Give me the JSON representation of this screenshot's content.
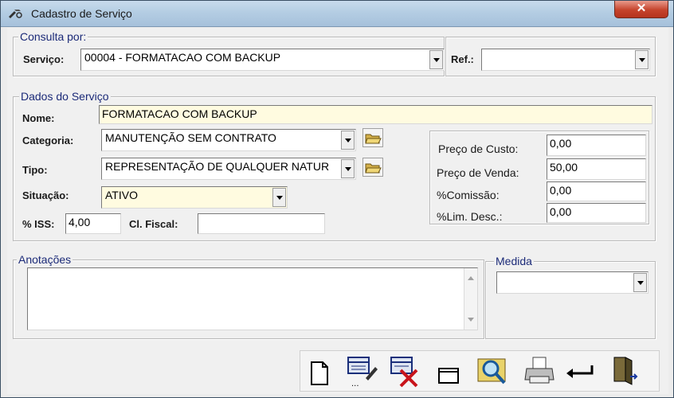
{
  "window": {
    "title": "Cadastro de Serviço",
    "close_label": "✕"
  },
  "consulta": {
    "legend": "Consulta por:",
    "servico_label": "Serviço:",
    "servico_value": "00004 - FORMATACAO COM BACKUP",
    "ref_label": "Ref.:",
    "ref_value": ""
  },
  "dados": {
    "legend": "Dados do Serviço",
    "nome_label": "Nome:",
    "nome_value": "FORMATACAO COM BACKUP",
    "categoria_label": "Categoria:",
    "categoria_value": "MANUTENÇÃO SEM CONTRATO",
    "tipo_label": "Tipo:",
    "tipo_value": "REPRESENTAÇÃO DE QUALQUER NATUR",
    "situacao_label": "Situação:",
    "situacao_value": "ATIVO",
    "iss_label": "% ISS:",
    "iss_value": "4,00",
    "clfiscal_label": "Cl. Fiscal:",
    "clfiscal_value": ""
  },
  "precos": {
    "custo_label": "Preço de Custo:",
    "custo_value": "0,00",
    "venda_label": "Preço de Venda:",
    "venda_value": "50,00",
    "comissao_label": "%Comissão:",
    "comissao_value": "0,00",
    "limdesc_label": "%Lim. Desc.:",
    "limdesc_value": "0,00"
  },
  "anotacoes": {
    "legend": "Anotações",
    "value": ""
  },
  "medida": {
    "legend": "Medida",
    "value": ""
  },
  "toolbar": {
    "icons": [
      "new-document-icon",
      "edit-record-icon",
      "delete-record-icon",
      "window-icon",
      "search-icon",
      "print-icon",
      "return-icon",
      "exit-door-icon"
    ]
  },
  "colors": {
    "legend": "#1b2a78",
    "highlight": "#fffbe0",
    "close": "#c5432c"
  }
}
